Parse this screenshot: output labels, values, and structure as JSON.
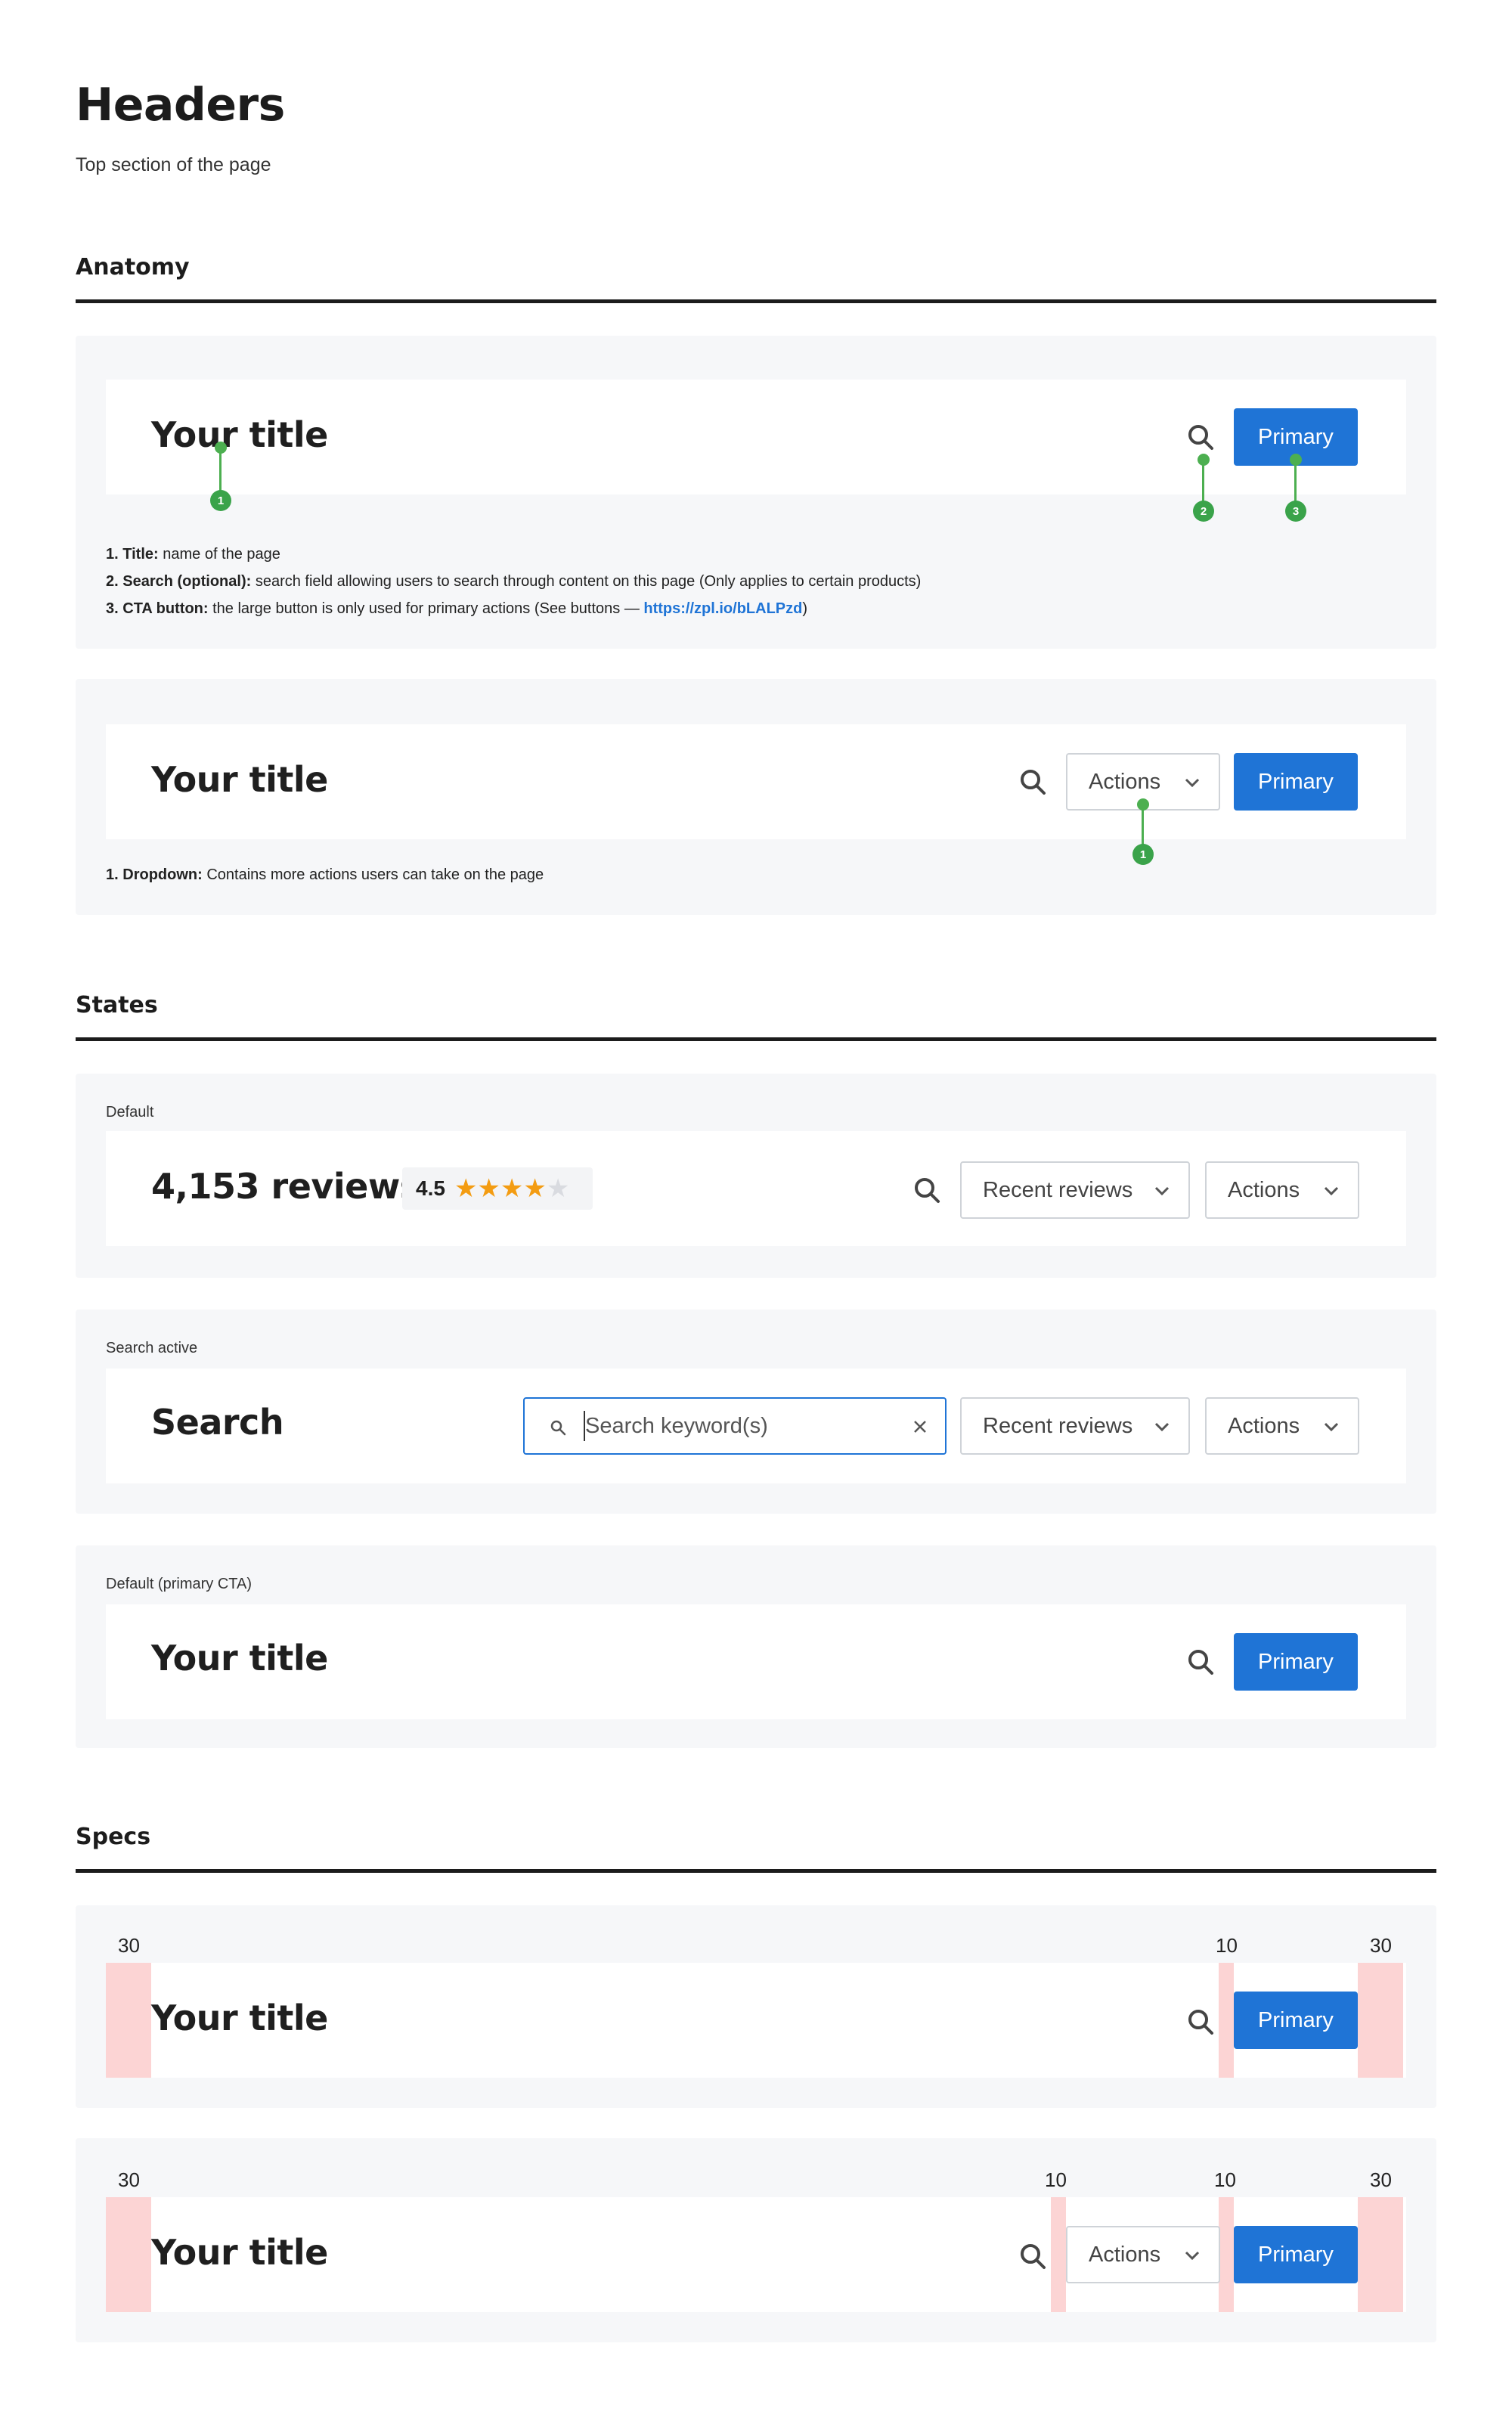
{
  "page": {
    "title": "Headers",
    "subtitle": "Top section of the page"
  },
  "sections": {
    "anatomy": "Anatomy",
    "states": "States",
    "specs": "Specs"
  },
  "anatomy": {
    "card1": {
      "title": "Your title",
      "primary_label": "Primary",
      "markers": [
        "1",
        "2",
        "3"
      ],
      "notes": [
        {
          "num": "1.",
          "term": "Title:",
          "text": " name of the page"
        },
        {
          "num": "2.",
          "term": "Search (optional):",
          "text": " search field allowing users to search through content on this page (Only applies to certain products)"
        },
        {
          "num": "3.",
          "term": "CTA button:",
          "text": " the large button is only used for primary actions (See buttons — ",
          "link": "https://zpl.io/bLALPzd",
          "tail": ")"
        }
      ]
    },
    "card2": {
      "title": "Your title",
      "actions_label": "Actions",
      "primary_label": "Primary",
      "markers": [
        "1"
      ],
      "notes": [
        {
          "num": "1.",
          "term": "Dropdown:",
          "text": " Contains more actions users can take on the page"
        }
      ]
    }
  },
  "states": {
    "default": {
      "label": "Default",
      "title": "4,153 reviews",
      "rating": "4.5",
      "rating_value": 4.5,
      "rating_max": 5,
      "sort_label": "Recent reviews",
      "actions_label": "Actions"
    },
    "search_active": {
      "label": "Search active",
      "title": "Search",
      "search_placeholder": "Search keyword(s)",
      "sort_label": "Recent reviews",
      "actions_label": "Actions"
    },
    "default_primary": {
      "label": "Default (primary CTA)",
      "title": "Your title",
      "primary_label": "Primary"
    }
  },
  "specs": {
    "spec1": {
      "title": "Your title",
      "primary_label": "Primary",
      "measures": [
        "30",
        "10",
        "30"
      ]
    },
    "spec2": {
      "title": "Your title",
      "actions_label": "Actions",
      "primary_label": "Primary",
      "measures": [
        "30",
        "10",
        "10",
        "30"
      ]
    }
  },
  "colors": {
    "primary": "#1f74d6",
    "marker": "#4caf50",
    "star": "#f39c12",
    "spec": "#fcd4d4"
  }
}
